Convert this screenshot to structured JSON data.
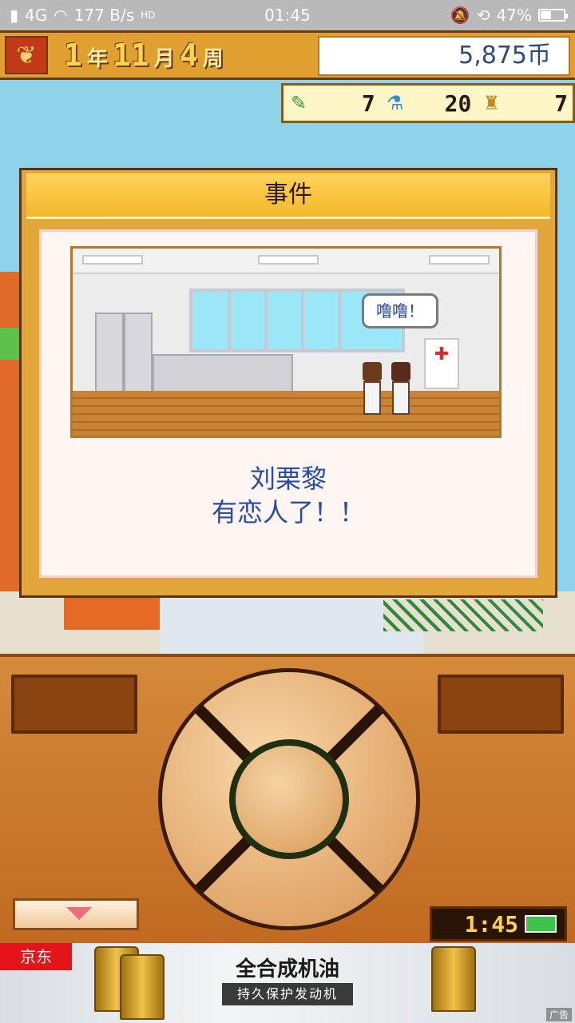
{
  "status_bar": {
    "network": "4G",
    "speed": "177 B/s",
    "hd": "HD",
    "time": "01:45",
    "battery_percent": "47%",
    "battery_level": 0.47
  },
  "top_bar": {
    "year_num": "1",
    "year_unit": "年",
    "month_num": "11",
    "month_unit": "月",
    "week_num": "4",
    "week_unit": "周",
    "money": "5,875币"
  },
  "stats": [
    {
      "icon": "pencil-icon",
      "glyph": "✎",
      "value": "7"
    },
    {
      "icon": "flask-icon",
      "glyph": "⚗",
      "value": "20"
    },
    {
      "icon": "trophy-icon",
      "glyph": "♜",
      "value": "7"
    }
  ],
  "event_dialog": {
    "title": "事件",
    "bubble_text": "噜噜！",
    "message_line1": "刘栗黎",
    "message_line2": "有恋人了！！"
  },
  "controller": {
    "clock_time": "1:45"
  },
  "ad": {
    "brand": "京东",
    "title": "全合成机油",
    "subtitle": "持久保护发动机",
    "tag": "广告"
  }
}
